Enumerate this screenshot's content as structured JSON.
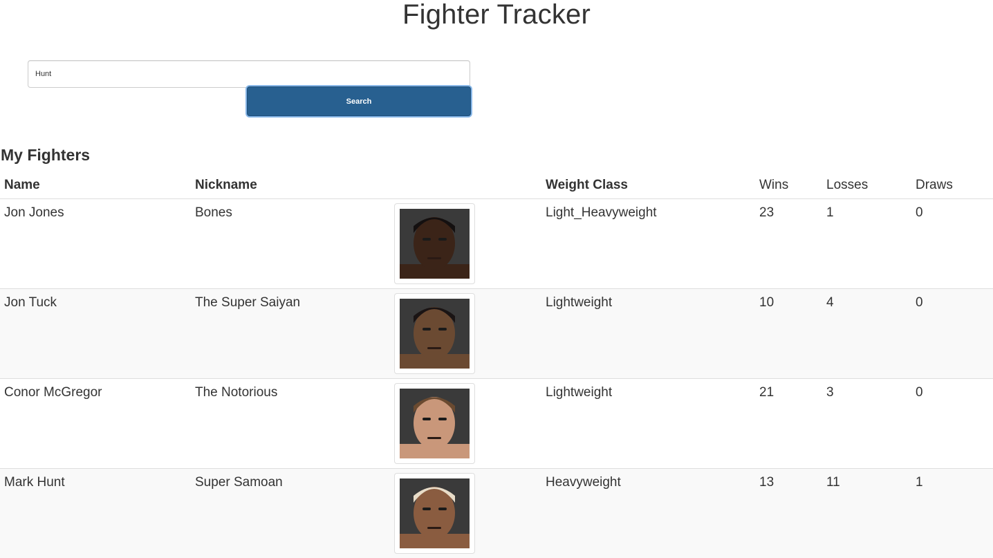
{
  "header": {
    "title": "Fighter Tracker"
  },
  "search": {
    "value": "Hunt",
    "button_label": "Search"
  },
  "section": {
    "title": "My Fighters"
  },
  "table": {
    "columns": [
      "Name",
      "Nickname",
      "",
      "Weight Class",
      "Wins",
      "Losses",
      "Draws"
    ],
    "rows": [
      {
        "name": "Jon Jones",
        "nickname": "Bones",
        "photo": "fighter-photo-icon",
        "weight_class": "Light_Heavyweight",
        "wins": "23",
        "losses": "1",
        "draws": "0"
      },
      {
        "name": "Jon Tuck",
        "nickname": "The Super Saiyan",
        "photo": "fighter-photo-icon",
        "weight_class": "Lightweight",
        "wins": "10",
        "losses": "4",
        "draws": "0"
      },
      {
        "name": "Conor McGregor",
        "nickname": "The Notorious",
        "photo": "fighter-photo-icon",
        "weight_class": "Lightweight",
        "wins": "21",
        "losses": "3",
        "draws": "0"
      },
      {
        "name": "Mark Hunt",
        "nickname": "Super Samoan",
        "photo": "fighter-photo-icon",
        "weight_class": "Heavyweight",
        "wins": "13",
        "losses": "11",
        "draws": "1"
      }
    ]
  },
  "colors": {
    "primary_button": "#286090",
    "row_stripe": "#f9f9f9",
    "border": "#dddddd"
  }
}
